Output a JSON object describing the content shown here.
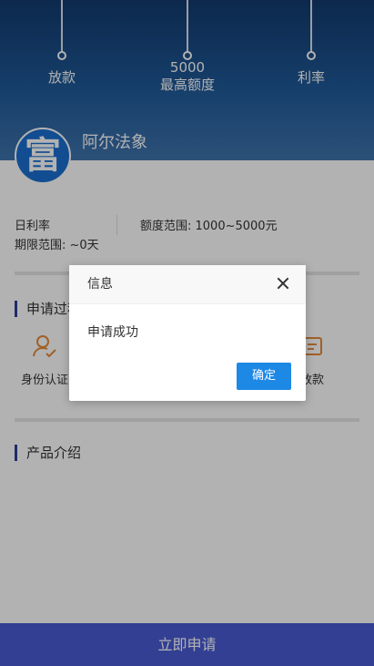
{
  "hero": {
    "items": [
      {
        "value": "",
        "label": "放款"
      },
      {
        "value": "5000",
        "label": "最高额度"
      },
      {
        "value": "",
        "label": "利率"
      }
    ]
  },
  "product": {
    "logo_char": "富",
    "name": "阿尔法象"
  },
  "info": {
    "daily_rate_label": "日利率",
    "range_label": "额度范围: 1000~5000元",
    "term_label": "期限范围: ~0天"
  },
  "process": {
    "title": "申请过程",
    "steps": [
      {
        "label": "身份认证",
        "icon": "user-check-icon"
      },
      {
        "label": "放款",
        "icon": "card-icon"
      }
    ]
  },
  "intro": {
    "title": "产品介绍"
  },
  "apply_button": "立即申请",
  "dialog": {
    "title": "信息",
    "message": "申请成功",
    "confirm": "确定"
  },
  "colors": {
    "primary": "#4a5bd3",
    "dialog_button": "#1e88e5",
    "section_bar": "#2f3d9a",
    "icon_orange": "#e58a3a"
  }
}
